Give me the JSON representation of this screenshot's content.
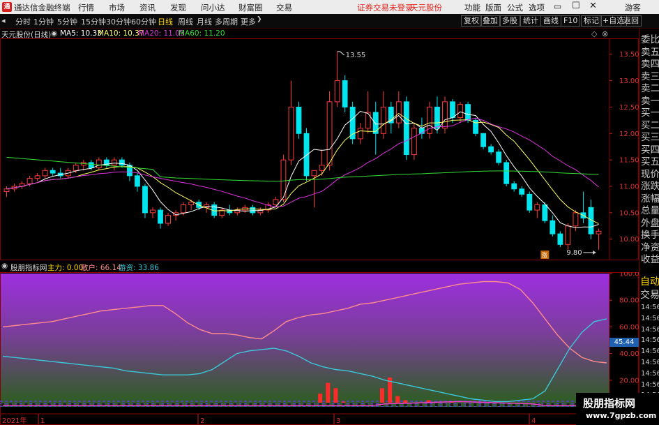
{
  "titlebar": {
    "logo_text": "通",
    "app_name": "通达信金融终端",
    "menus": [
      "行情",
      "市场",
      "资讯",
      "发现",
      "问小达",
      "财富圈",
      "交易"
    ],
    "warning": "证券交易未登录",
    "stock": "天元股份",
    "right_menus": [
      "功能",
      "版面",
      "公式",
      "选项"
    ],
    "user": "游客"
  },
  "toolbar": {
    "periods": [
      "分时",
      "1分钟",
      "5分钟",
      "15分钟",
      "30分钟",
      "60分钟",
      "日线",
      "周线",
      "月线",
      "多周期",
      "更多"
    ],
    "active_period": "日线",
    "right_buttons": [
      "复权",
      "叠加",
      "多股",
      "统计",
      "画线",
      "F10",
      "标记",
      "+自选",
      "返回"
    ]
  },
  "chart_info": {
    "stock_title": "天元股份(日线)",
    "ma5": "MA5: 10.33",
    "ma10": "MA10: 10.37",
    "ma20": "MA20: 11.05",
    "ma60": "MA60: 11.20"
  },
  "indicator_info": {
    "name": "股朋指标网",
    "zhuli": "主力: 0.00",
    "sanhu": "散户: 66.14",
    "youzi": "游资: 33.86"
  },
  "right_panel": {
    "items": [
      "委比",
      "卖五",
      "卖四",
      "卖三",
      "卖二",
      "卖一",
      "买一",
      "买二",
      "买三",
      "买四",
      "买五",
      "现价",
      "涨跌",
      "涨幅",
      "总量",
      "外盘",
      "换手",
      "净资",
      "收益"
    ],
    "lower_items": [
      "自动",
      "交易"
    ],
    "times": [
      "14:56",
      "14:56",
      "14:56",
      "14:56",
      "14:56",
      "14:56",
      "14:56",
      "14:56",
      "14:56",
      "14:56",
      "14:56"
    ],
    "badge": "45.44"
  },
  "annotations": {
    "high": "13.55",
    "low": "9.80",
    "limit_badge": "涨"
  },
  "time_axis": {
    "year": "2021年",
    "months": [
      "1",
      "2",
      "3",
      "4"
    ]
  },
  "watermark": {
    "title": "股朋指标网",
    "url": "www.7gpzb.com"
  },
  "colors": {
    "up": "#ff3b3b",
    "down": "#00e5ee",
    "ma5": "#ffffff",
    "ma10": "#ffff66",
    "ma20": "#dd33dd",
    "ma60": "#33dd33",
    "panel_top": "#9d2fe0",
    "panel_bottom": "#2a5f1c",
    "sanhu": "#ff8c8c",
    "youzi": "#3bc8d8"
  },
  "chart_data": [
    {
      "type": "candlestick",
      "title": "天元股份(日线)",
      "y_axis_ticks": [
        13.5,
        13.0,
        12.5,
        12.0,
        11.5,
        11.0,
        10.5,
        10.0
      ],
      "ylim": [
        9.6,
        13.8
      ],
      "candles_ohlc": [
        [
          10.9,
          11.0,
          10.8,
          10.95
        ],
        [
          10.95,
          11.05,
          10.9,
          11.0
        ],
        [
          11.0,
          11.1,
          10.95,
          11.05
        ],
        [
          11.05,
          11.2,
          11.0,
          11.15
        ],
        [
          11.15,
          11.25,
          11.1,
          11.2
        ],
        [
          11.2,
          11.35,
          11.15,
          11.3
        ],
        [
          11.3,
          11.35,
          11.2,
          11.25
        ],
        [
          11.25,
          11.35,
          11.15,
          11.2
        ],
        [
          11.2,
          11.35,
          11.15,
          11.3
        ],
        [
          11.3,
          11.45,
          11.25,
          11.4
        ],
        [
          11.4,
          11.5,
          11.3,
          11.45
        ],
        [
          11.45,
          11.5,
          11.3,
          11.35
        ],
        [
          11.35,
          11.55,
          11.3,
          11.5
        ],
        [
          11.5,
          11.55,
          11.35,
          11.4
        ],
        [
          11.4,
          11.55,
          11.3,
          11.5
        ],
        [
          11.5,
          11.55,
          11.35,
          11.4
        ],
        [
          11.4,
          11.45,
          11.1,
          11.2
        ],
        [
          11.2,
          11.25,
          10.9,
          11.0
        ],
        [
          11.0,
          11.05,
          10.4,
          10.5
        ],
        [
          10.5,
          10.6,
          10.4,
          10.55
        ],
        [
          10.55,
          10.6,
          10.2,
          10.3
        ],
        [
          10.3,
          10.5,
          10.25,
          10.45
        ],
        [
          10.45,
          10.55,
          10.35,
          10.5
        ],
        [
          10.5,
          10.7,
          10.45,
          10.65
        ],
        [
          10.65,
          10.75,
          10.55,
          10.7
        ],
        [
          10.7,
          10.75,
          10.55,
          10.6
        ],
        [
          10.6,
          10.7,
          10.5,
          10.65
        ],
        [
          10.65,
          10.7,
          10.4,
          10.45
        ],
        [
          10.45,
          10.6,
          10.4,
          10.55
        ],
        [
          10.55,
          10.65,
          10.45,
          10.5
        ],
        [
          10.5,
          10.6,
          10.45,
          10.55
        ],
        [
          10.55,
          10.65,
          10.5,
          10.6
        ],
        [
          10.6,
          10.65,
          10.45,
          10.5
        ],
        [
          10.5,
          10.6,
          10.45,
          10.55
        ],
        [
          10.55,
          10.7,
          10.5,
          10.65
        ],
        [
          10.65,
          10.8,
          10.6,
          10.75
        ],
        [
          10.75,
          11.6,
          10.7,
          11.5
        ],
        [
          11.5,
          13.0,
          11.4,
          12.5
        ],
        [
          12.5,
          12.6,
          11.9,
          12.0
        ],
        [
          12.0,
          12.1,
          11.1,
          11.2
        ],
        [
          11.2,
          11.3,
          10.6,
          11.3
        ],
        [
          11.3,
          11.7,
          11.2,
          11.4
        ],
        [
          11.4,
          12.8,
          11.3,
          12.6
        ],
        [
          12.6,
          13.55,
          12.5,
          13.0
        ],
        [
          13.0,
          13.1,
          12.4,
          12.5
        ],
        [
          12.5,
          12.6,
          11.8,
          11.9
        ],
        [
          11.9,
          12.2,
          11.8,
          12.1
        ],
        [
          12.1,
          12.8,
          12.0,
          12.4
        ],
        [
          12.4,
          12.6,
          11.6,
          12.0
        ],
        [
          12.0,
          12.8,
          11.9,
          12.5
        ],
        [
          12.5,
          12.6,
          12.0,
          12.2
        ],
        [
          12.2,
          12.8,
          12.1,
          12.6
        ],
        [
          12.6,
          12.7,
          11.5,
          11.6
        ],
        [
          11.6,
          12.2,
          11.5,
          12.1
        ],
        [
          12.1,
          12.3,
          11.9,
          12.0
        ],
        [
          12.0,
          12.6,
          11.9,
          12.5
        ],
        [
          12.5,
          12.7,
          12.0,
          12.1
        ],
        [
          12.1,
          12.7,
          12.0,
          12.6
        ],
        [
          12.6,
          12.65,
          12.2,
          12.3
        ],
        [
          12.3,
          12.6,
          12.2,
          12.55
        ],
        [
          12.55,
          12.6,
          12.2,
          12.25
        ],
        [
          12.25,
          12.3,
          11.95,
          12.0
        ],
        [
          12.0,
          12.0,
          11.7,
          11.75
        ],
        [
          11.75,
          11.8,
          11.6,
          11.65
        ],
        [
          11.65,
          11.7,
          11.4,
          11.45
        ],
        [
          11.45,
          11.5,
          11.0,
          11.05
        ],
        [
          11.05,
          11.1,
          10.9,
          10.95
        ],
        [
          10.95,
          11.0,
          10.8,
          10.85
        ],
        [
          10.85,
          10.9,
          10.5,
          10.55
        ],
        [
          10.55,
          10.7,
          10.4,
          10.65
        ],
        [
          10.65,
          10.7,
          10.3,
          10.35
        ],
        [
          10.35,
          10.45,
          10.05,
          10.1
        ],
        [
          10.1,
          10.15,
          9.85,
          9.9
        ],
        [
          9.9,
          10.3,
          9.8,
          10.25
        ],
        [
          10.25,
          10.55,
          10.15,
          10.5
        ],
        [
          10.5,
          10.9,
          10.3,
          10.4
        ],
        [
          10.6,
          10.75,
          10.0,
          10.1
        ],
        [
          10.1,
          10.2,
          9.8,
          10.15
        ]
      ],
      "ma5": [
        10.33
      ],
      "ma10": [
        10.37
      ],
      "ma20": [
        11.05
      ],
      "ma60": [
        11.2
      ],
      "annotations": [
        "13.55",
        "9.80"
      ]
    },
    {
      "type": "line",
      "title": "股朋指标网",
      "y_axis_ticks": [
        100.0,
        80.0,
        60.0,
        40.0,
        20.0
      ],
      "ylim": [
        0,
        100
      ],
      "series": [
        {
          "name": "散户",
          "values": [
            60,
            61,
            62,
            63,
            64,
            66,
            68,
            70,
            72,
            73,
            74,
            75,
            76,
            76,
            70,
            63,
            58,
            55,
            55,
            54,
            52,
            51,
            57,
            64,
            67,
            69,
            70,
            72,
            74,
            77,
            78,
            80,
            82,
            84,
            86,
            88,
            90,
            92,
            93,
            94,
            94,
            93,
            88,
            78,
            66,
            54,
            44,
            37,
            34,
            33
          ]
        },
        {
          "name": "游资",
          "values": [
            38,
            37,
            36,
            35,
            34,
            33,
            32,
            31,
            30,
            29,
            27,
            26,
            25,
            24,
            24,
            24,
            25,
            28,
            34,
            40,
            42,
            43,
            44,
            42,
            38,
            33,
            30,
            28,
            27,
            25,
            23,
            20,
            18,
            16,
            14,
            12,
            10,
            8,
            6,
            5,
            4,
            4,
            5,
            6,
            12,
            28,
            44,
            56,
            64,
            66
          ]
        },
        {
          "name": "主力",
          "values": [
            0,
            0,
            0,
            0,
            0,
            0,
            0,
            0,
            0,
            0,
            0,
            0,
            0,
            0,
            0,
            0,
            0,
            0,
            0,
            0,
            0,
            0,
            0,
            0,
            0,
            0,
            0,
            0,
            0,
            0,
            0,
            0,
            0,
            0,
            0,
            0,
            0,
            0,
            0,
            0,
            0,
            0,
            0,
            0,
            0,
            0,
            0,
            0,
            0,
            0
          ]
        }
      ],
      "bars": [
        {
          "x": 41,
          "value": 10
        },
        {
          "x": 42,
          "value": 18
        },
        {
          "x": 43,
          "value": 14
        },
        {
          "x": 44,
          "value": 4
        },
        {
          "x": 49,
          "value": 14
        },
        {
          "x": 50,
          "value": 22
        },
        {
          "x": 51,
          "value": 8
        },
        {
          "x": 52,
          "value": 5
        },
        {
          "x": 54,
          "value": 3
        },
        {
          "x": 55,
          "value": 5
        },
        {
          "x": 58,
          "value": 4
        },
        {
          "x": 62,
          "value": 2
        }
      ]
    }
  ]
}
